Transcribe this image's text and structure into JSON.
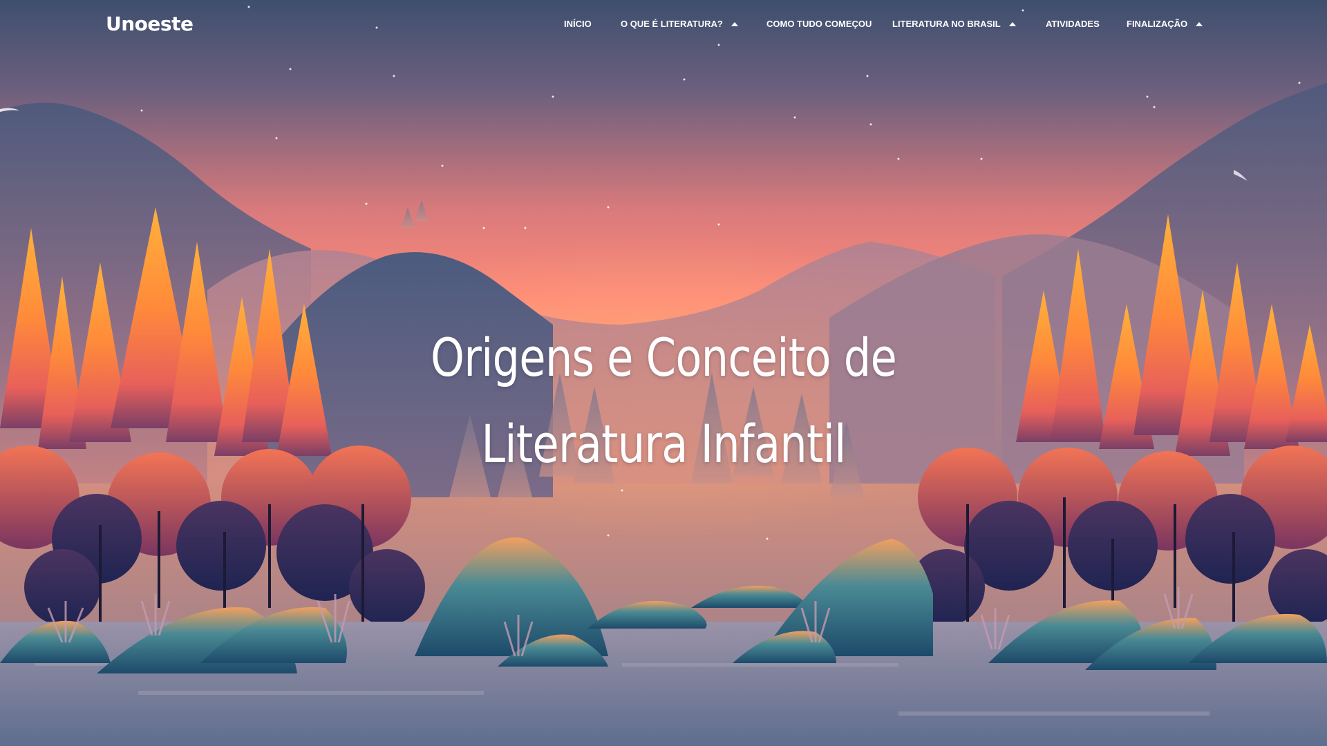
{
  "brand": {
    "logo_text": "Unoeste"
  },
  "nav": {
    "items": [
      {
        "label": "INÍCIO",
        "has_dropdown": false
      },
      {
        "label": "O QUE É LITERATURA?",
        "has_dropdown": true
      },
      {
        "label": "COMO TUDO COMEÇOU",
        "has_dropdown": false
      },
      {
        "label": "LITERATURA NO BRASIL",
        "has_dropdown": true
      },
      {
        "label": "ATIVIDADES",
        "has_dropdown": false
      },
      {
        "label": "FINALIZAÇÃO",
        "has_dropdown": true
      }
    ]
  },
  "hero": {
    "title_line1": "Origens e Conceito de",
    "title_line2": "Literatura Infantil"
  },
  "colors": {
    "sky_top": "#3e4f6e",
    "sky_glow": "#ff8a78",
    "horizon": "#f7a070",
    "mountain_far": "#a97e90",
    "mountain_mid": "#4e5d80",
    "tree_orange": "#ff9a3c",
    "tree_red": "#e05c5a",
    "tree_dark": "#2b2a55",
    "water": "#6f7c99"
  }
}
